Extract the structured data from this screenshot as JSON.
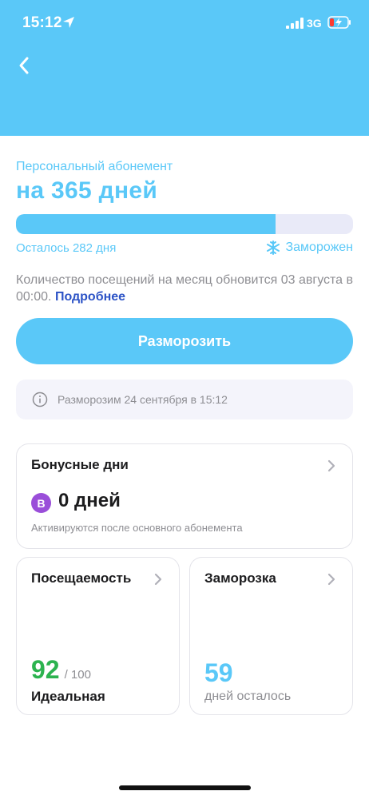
{
  "status_bar": {
    "time": "15:12",
    "network": "3G",
    "icons": [
      "location-arrow-icon",
      "signal-icon",
      "battery-charging-icon"
    ]
  },
  "header": {
    "color": "#5ac8f8",
    "back_icon": "chevron-left-icon"
  },
  "subscription": {
    "type": "Персональный абонемент",
    "title": "на 365 дней",
    "progress_fraction": 0.77,
    "remaining": "Осталось 282 дня",
    "status": "Заморожен",
    "status_icon": "snowflake-icon",
    "visits_info": "Количество посещений на месяц обновится 03 августа в 00:00.",
    "more_link": "Подробнее",
    "unfreeze_button": "Разморозить",
    "notice": "Разморозим 24 сентября в 15:12",
    "notice_icon": "info-icon"
  },
  "bonus_card": {
    "title": "Бонусные дни",
    "badge": "B",
    "value": "0 дней",
    "note": "Активируются после основного абонемента"
  },
  "attendance_card": {
    "title": "Посещаемость",
    "value": "92",
    "max": "/ 100",
    "label": "Идеальная"
  },
  "freeze_card": {
    "title": "Заморозка",
    "value": "59",
    "label": "дней осталось"
  },
  "colors": {
    "accent": "#5ac8f8",
    "link": "#2c53c6",
    "success": "#2cb34f",
    "bonus_badge": "#9a4ed9",
    "muted": "#8e8e93"
  }
}
